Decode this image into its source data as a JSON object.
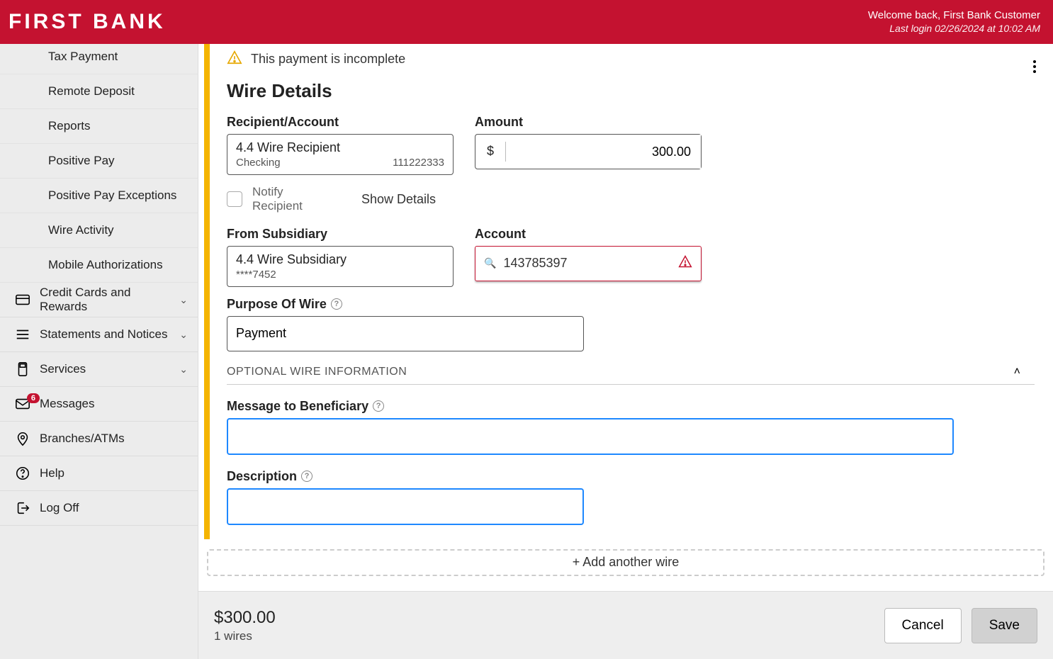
{
  "header": {
    "logo": "FIRST BANK",
    "welcome": "Welcome back, First Bank Customer",
    "last_login": "Last login 02/26/2024 at 10:02 AM"
  },
  "sidebar": {
    "items": [
      {
        "label": "Tax Payment",
        "sub": true
      },
      {
        "label": "Remote Deposit",
        "sub": true
      },
      {
        "label": "Reports",
        "sub": true
      },
      {
        "label": "Positive Pay",
        "sub": true
      },
      {
        "label": "Positive Pay Exceptions",
        "sub": true
      },
      {
        "label": "Wire Activity",
        "sub": true
      },
      {
        "label": "Mobile Authorizations",
        "sub": true
      },
      {
        "label": "Credit Cards and Rewards",
        "icon": "card",
        "chevron": true
      },
      {
        "label": "Statements and Notices",
        "icon": "menu",
        "chevron": true
      },
      {
        "label": "Services",
        "icon": "device",
        "chevron": true
      },
      {
        "label": "Messages",
        "icon": "mail",
        "badge": "6"
      },
      {
        "label": "Branches/ATMs",
        "icon": "pin"
      },
      {
        "label": "Help",
        "icon": "help"
      },
      {
        "label": "Log Off",
        "icon": "logout"
      }
    ]
  },
  "wire": {
    "warning": "This payment is incomplete",
    "section_title": "Wire Details",
    "recipient_label": "Recipient/Account",
    "recipient_name": "4.4 Wire Recipient",
    "recipient_type": "Checking",
    "recipient_acct": "111222333",
    "amount_label": "Amount",
    "currency": "$",
    "amount_value": "300.00",
    "notify_label": "Notify Recipient",
    "show_details": "Show Details",
    "from_sub_label": "From Subsidiary",
    "from_sub_name": "4.4 Wire Subsidiary",
    "from_sub_mask": "****7452",
    "account_label": "Account",
    "account_value": "143785397",
    "purpose_label": "Purpose Of Wire",
    "purpose_value": "Payment",
    "optional_title": "OPTIONAL WIRE INFORMATION",
    "msg_label": "Message to Beneficiary",
    "desc_label": "Description",
    "add_another": "+ Add another wire"
  },
  "footer": {
    "total": "$300.00",
    "count": "1 wires",
    "cancel": "Cancel",
    "save": "Save"
  }
}
